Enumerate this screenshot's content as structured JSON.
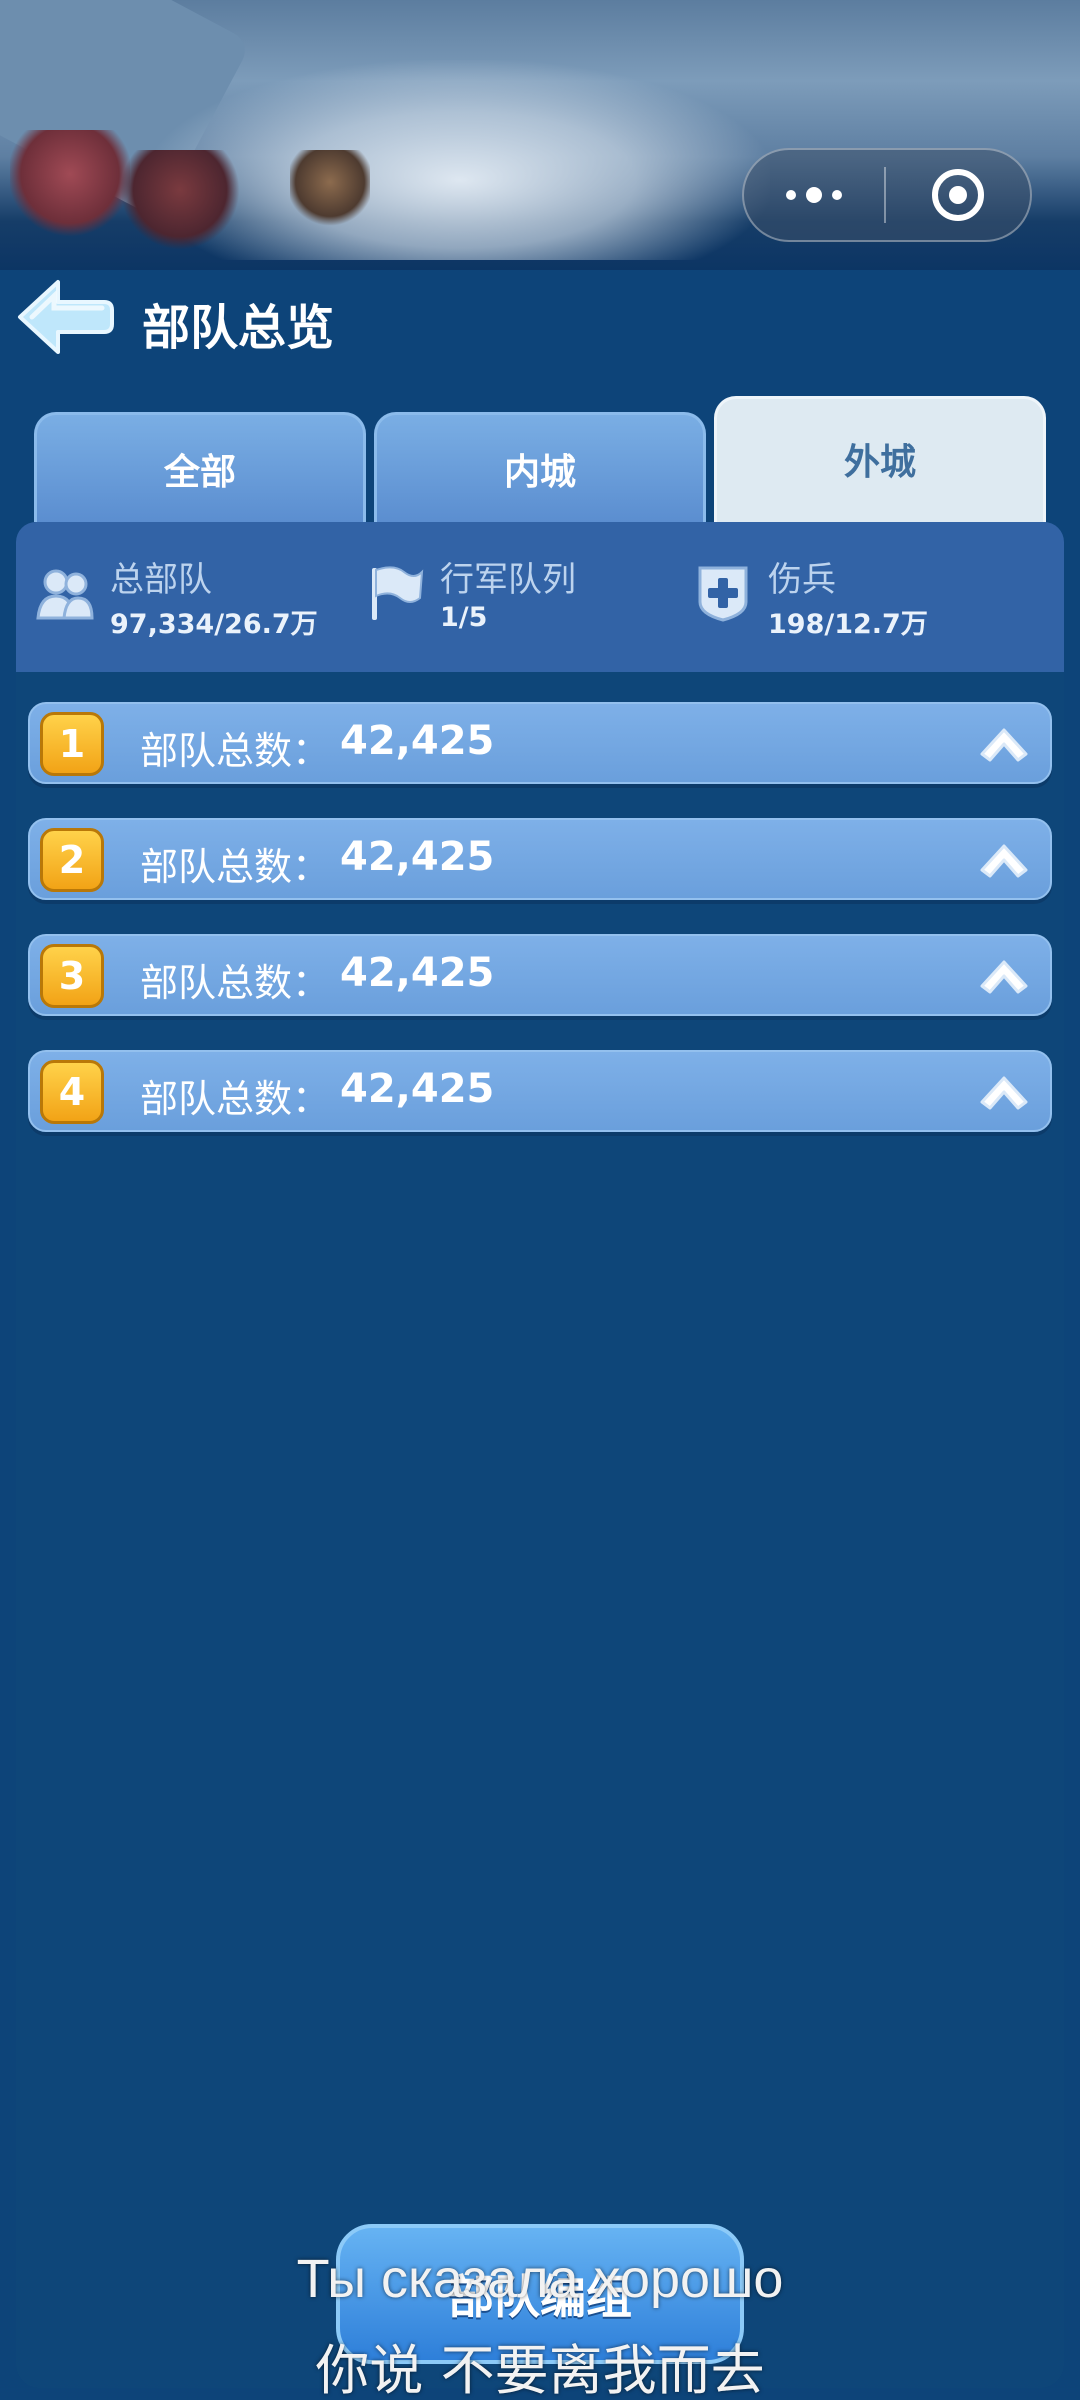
{
  "header": {
    "title": "部队总览"
  },
  "tabs": [
    {
      "label": "全部",
      "active": false
    },
    {
      "label": "内城",
      "active": false
    },
    {
      "label": "外城",
      "active": true
    }
  ],
  "stats": [
    {
      "icon": "troops-icon",
      "label": "总部队",
      "value": "97,334/26.7万"
    },
    {
      "icon": "flag-icon",
      "label": "行军队列",
      "value": "1/5"
    },
    {
      "icon": "medical-cross-icon",
      "label": "伤兵",
      "value": "198/12.7万"
    }
  ],
  "troops": [
    {
      "index": "1",
      "label": "部队总数：",
      "count": "42,425"
    },
    {
      "index": "2",
      "label": "部队总数：",
      "count": "42,425"
    },
    {
      "index": "3",
      "label": "部队总数：",
      "count": "42,425"
    },
    {
      "index": "4",
      "label": "部队总数：",
      "count": "42,425"
    }
  ],
  "footer": {
    "button_label": "部队编组"
  },
  "subtitles": {
    "line1": "Ты сказала хорошо",
    "line2": "你说 不要离我而去"
  },
  "colors": {
    "background": "#0d4479",
    "stats_bar": "#3263a6",
    "row": "#6a9fdc",
    "badge": "#f2a316",
    "active_tab": "#deeaf2"
  }
}
